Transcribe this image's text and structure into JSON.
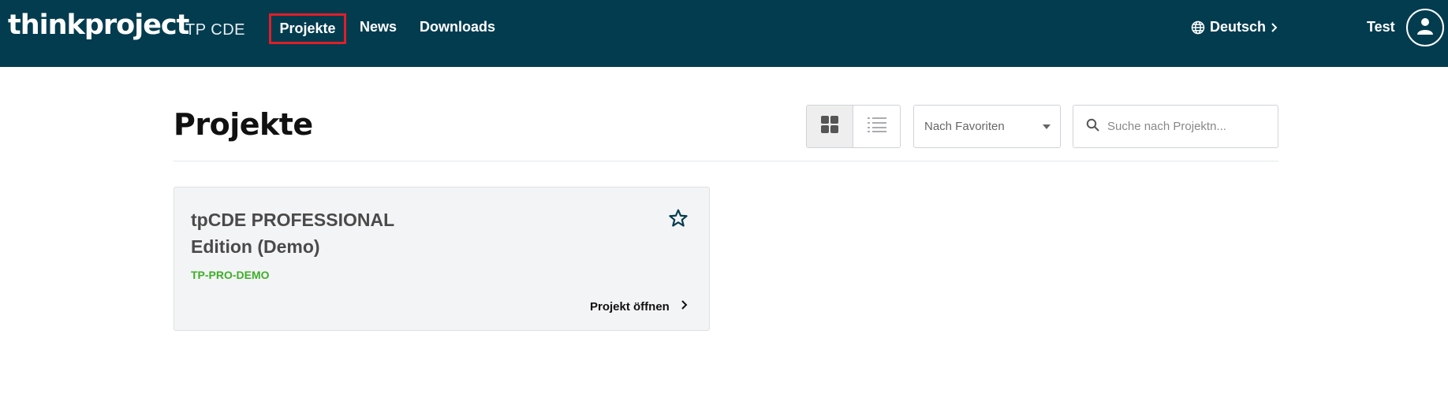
{
  "header": {
    "brand": "thinkproject",
    "product": "TP CDE",
    "nav": [
      {
        "label": "Projekte",
        "active": true
      },
      {
        "label": "News"
      },
      {
        "label": "Downloads"
      }
    ],
    "language": "Deutsch",
    "user_name": "Test",
    "colors": {
      "bar": "#033c4f",
      "active_outline": "#e01e27"
    }
  },
  "main": {
    "title": "Projekte",
    "view_modes": [
      "grid",
      "list"
    ],
    "active_view": "grid",
    "sort": {
      "selected": "Nach Favoriten"
    },
    "search": {
      "placeholder": "Suche nach Projektn...",
      "value": ""
    }
  },
  "projects": [
    {
      "title": "tpCDE PROFESSIONAL Edition (Demo)",
      "code": "TP-PRO-DEMO",
      "open_label": "Projekt öffnen",
      "favorite": false,
      "code_color": "#3fae2a"
    }
  ]
}
